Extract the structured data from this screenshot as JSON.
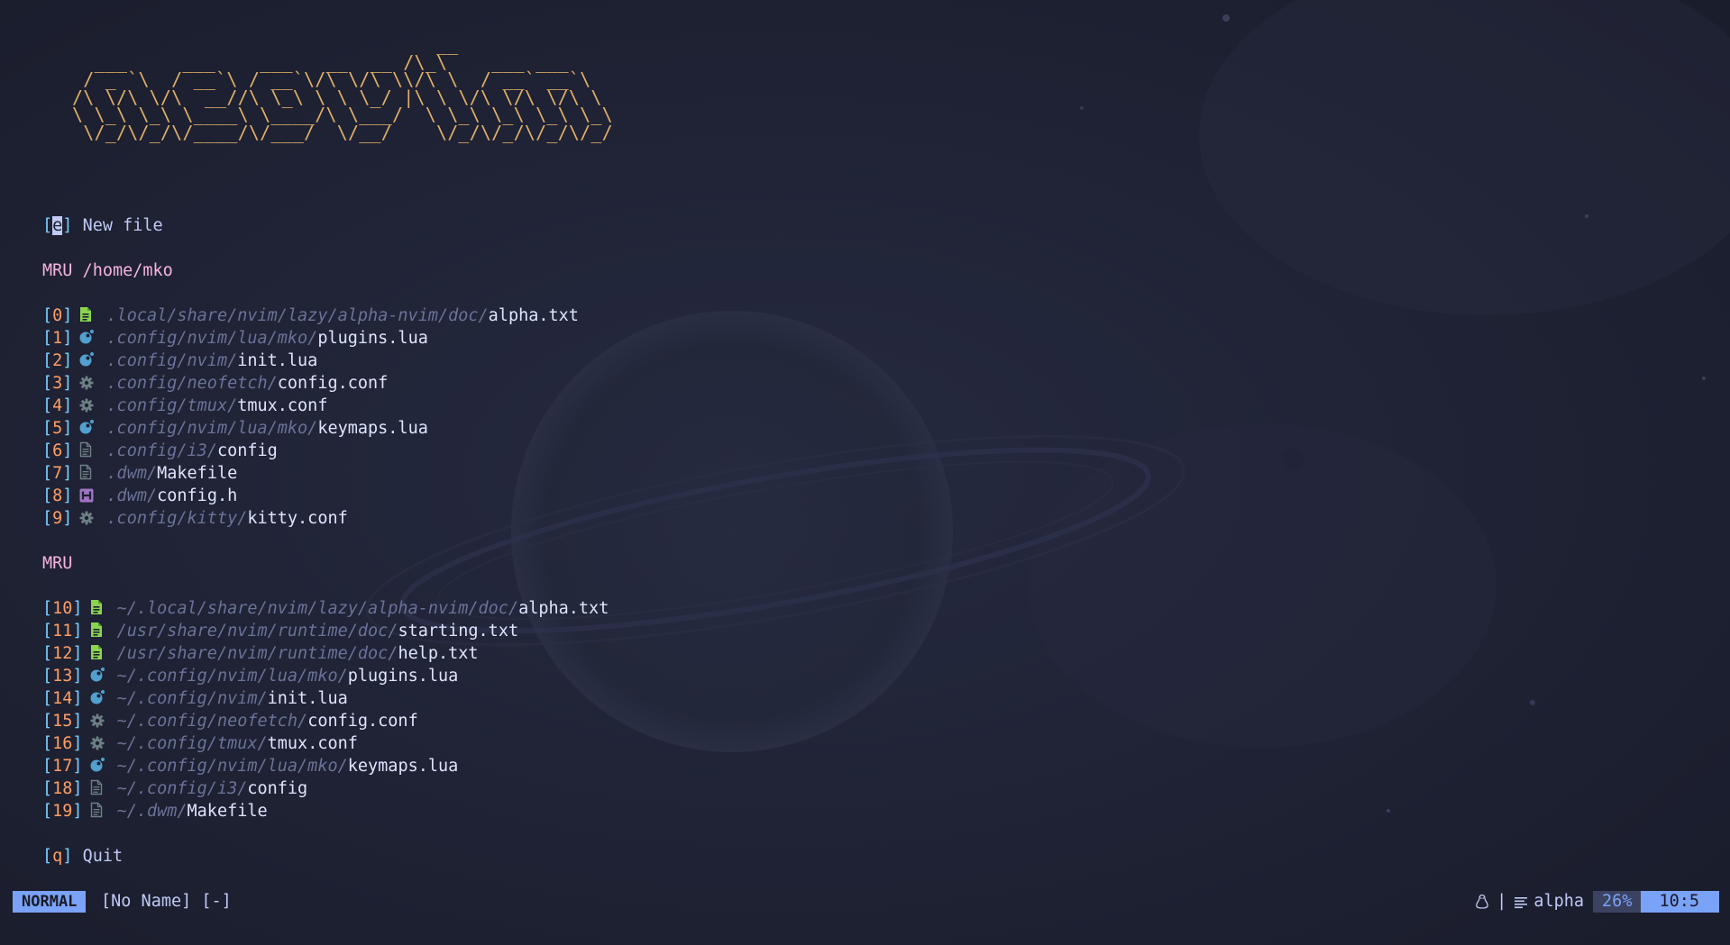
{
  "ascii_logo": "                                 __\n  ___     ___    ___   __  __ /\\_\\    ___ ___\n / _ `\\  / __`\\ / __`\\/\\ \\/\\ \\\\/\\ \\  / __` __`\\\n/\\ \\/\\ \\/\\  __//\\ \\_\\ \\ \\ \\_/ |\\ \\ \\/\\ \\/\\ \\/\\ \\\n\\ \\_\\ \\_\\ \\____\\ \\____/\\ \\___/  \\ \\_\\ \\_\\ \\_\\ \\_\\\n \\/_/\\/_/\\/____/\\/___/  \\/__/    \\/_/\\/_/\\/_/\\/_/",
  "new_file": {
    "key": "e",
    "label": "New file"
  },
  "mru_local": {
    "header": "MRU /home/mko",
    "items": [
      {
        "key": "0",
        "icon": "text-file-icon",
        "dir": ".local/share/nvim/lazy/alpha-nvim/doc/",
        "file": "alpha.txt"
      },
      {
        "key": "1",
        "icon": "lua-icon",
        "dir": ".config/nvim/lua/mko/",
        "file": "plugins.lua"
      },
      {
        "key": "2",
        "icon": "lua-icon",
        "dir": ".config/nvim/",
        "file": "init.lua"
      },
      {
        "key": "3",
        "icon": "gear-icon",
        "dir": ".config/neofetch/",
        "file": "config.conf"
      },
      {
        "key": "4",
        "icon": "gear-icon",
        "dir": ".config/tmux/",
        "file": "tmux.conf"
      },
      {
        "key": "5",
        "icon": "lua-icon",
        "dir": ".config/nvim/lua/mko/",
        "file": "keymaps.lua"
      },
      {
        "key": "6",
        "icon": "document-icon",
        "dir": ".config/i3/",
        "file": "config"
      },
      {
        "key": "7",
        "icon": "document-icon",
        "dir": ".dwm/",
        "file": "Makefile"
      },
      {
        "key": "8",
        "icon": "header-file-icon",
        "dir": ".dwm/",
        "file": "config.h"
      },
      {
        "key": "9",
        "icon": "gear-icon",
        "dir": ".config/kitty/",
        "file": "kitty.conf"
      }
    ]
  },
  "mru_global": {
    "header": "MRU",
    "items": [
      {
        "key": "10",
        "icon": "text-file-icon",
        "dir": "~/.local/share/nvim/lazy/alpha-nvim/doc/",
        "file": "alpha.txt"
      },
      {
        "key": "11",
        "icon": "text-file-icon",
        "dir": "/usr/share/nvim/runtime/doc/",
        "file": "starting.txt"
      },
      {
        "key": "12",
        "icon": "text-file-icon",
        "dir": "/usr/share/nvim/runtime/doc/",
        "file": "help.txt"
      },
      {
        "key": "13",
        "icon": "lua-icon",
        "dir": "~/.config/nvim/lua/mko/",
        "file": "plugins.lua"
      },
      {
        "key": "14",
        "icon": "lua-icon",
        "dir": "~/.config/nvim/",
        "file": "init.lua"
      },
      {
        "key": "15",
        "icon": "gear-icon",
        "dir": "~/.config/neofetch/",
        "file": "config.conf"
      },
      {
        "key": "16",
        "icon": "gear-icon",
        "dir": "~/.config/tmux/",
        "file": "tmux.conf"
      },
      {
        "key": "17",
        "icon": "lua-icon",
        "dir": "~/.config/nvim/lua/mko/",
        "file": "keymaps.lua"
      },
      {
        "key": "18",
        "icon": "document-icon",
        "dir": "~/.config/i3/",
        "file": "config"
      },
      {
        "key": "19",
        "icon": "document-icon",
        "dir": "~/.dwm/",
        "file": "Makefile"
      }
    ]
  },
  "quit": {
    "key": "q",
    "label": "Quit"
  },
  "statusline": {
    "mode": "NORMAL",
    "filename": "[No Name] [-]",
    "os_icon": "linux-tux-icon",
    "separator": "|",
    "filetype_icon": "lines-icon",
    "filetype": "alpha",
    "percent": "26%",
    "position": "10:5"
  },
  "colors": {
    "background": "#1c1f30",
    "ascii": "#e0af68",
    "key": "#ff9e64",
    "bracket": "#7dcfff",
    "header": "#f7b3e0",
    "dir": "#6a7398",
    "file": "#dfe4ff",
    "mode_bg": "#7aa2f7",
    "percent_bg": "#3b4261",
    "text_icon": "#8bd450",
    "lua_icon": "#51a0cf",
    "gear_icon": "#6d8086",
    "header_icon": "#a074c4"
  }
}
